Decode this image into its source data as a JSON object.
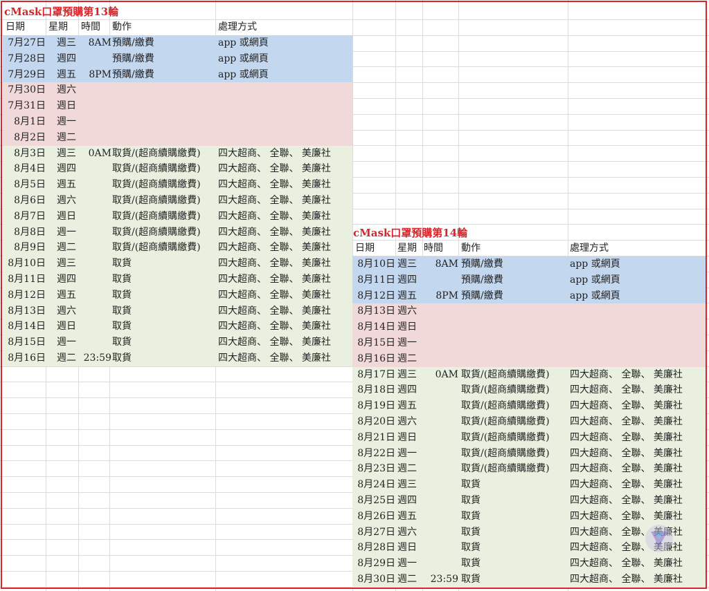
{
  "round13": {
    "title": "cMask口罩預購第13輪",
    "headers": [
      "日期",
      "星期",
      "時間",
      "動作",
      "處理方式"
    ],
    "rows": [
      {
        "date": "7月27日",
        "weekday": "週三",
        "time": "8AM",
        "action": "預購/繳費",
        "method": "app 或網頁",
        "color": "blue"
      },
      {
        "date": "7月28日",
        "weekday": "週四",
        "time": "",
        "action": "預購/繳費",
        "method": "app 或網頁",
        "color": "blue"
      },
      {
        "date": "7月29日",
        "weekday": "週五",
        "time": "8PM",
        "action": "預購/繳費",
        "method": "app 或網頁",
        "color": "blue"
      },
      {
        "date": "7月30日",
        "weekday": "週六",
        "time": "",
        "action": "",
        "method": "",
        "color": "pink"
      },
      {
        "date": "7月31日",
        "weekday": "週日",
        "time": "",
        "action": "",
        "method": "",
        "color": "pink"
      },
      {
        "date": "8月1日",
        "weekday": "週一",
        "time": "",
        "action": "",
        "method": "",
        "color": "pink"
      },
      {
        "date": "8月2日",
        "weekday": "週二",
        "time": "",
        "action": "",
        "method": "",
        "color": "pink"
      },
      {
        "date": "8月3日",
        "weekday": "週三",
        "time": "0AM",
        "action": "取貨/(超商續購繳費)",
        "method": "四大超商、 全聯、 美廉社",
        "color": "green"
      },
      {
        "date": "8月4日",
        "weekday": "週四",
        "time": "",
        "action": "取貨/(超商續購繳費)",
        "method": "四大超商、 全聯、 美廉社",
        "color": "green"
      },
      {
        "date": "8月5日",
        "weekday": "週五",
        "time": "",
        "action": "取貨/(超商續購繳費)",
        "method": "四大超商、 全聯、 美廉社",
        "color": "green"
      },
      {
        "date": "8月6日",
        "weekday": "週六",
        "time": "",
        "action": "取貨/(超商續購繳費)",
        "method": "四大超商、 全聯、 美廉社",
        "color": "green"
      },
      {
        "date": "8月7日",
        "weekday": "週日",
        "time": "",
        "action": "取貨/(超商續購繳費)",
        "method": "四大超商、 全聯、 美廉社",
        "color": "green"
      },
      {
        "date": "8月8日",
        "weekday": "週一",
        "time": "",
        "action": "取貨/(超商續購繳費)",
        "method": "四大超商、 全聯、 美廉社",
        "color": "green"
      },
      {
        "date": "8月9日",
        "weekday": "週二",
        "time": "",
        "action": "取貨/(超商續購繳費)",
        "method": "四大超商、 全聯、 美廉社",
        "color": "green"
      },
      {
        "date": "8月10日",
        "weekday": "週三",
        "time": "",
        "action": "取貨",
        "method": "四大超商、 全聯、 美廉社",
        "color": "green"
      },
      {
        "date": "8月11日",
        "weekday": "週四",
        "time": "",
        "action": "取貨",
        "method": "四大超商、 全聯、 美廉社",
        "color": "green"
      },
      {
        "date": "8月12日",
        "weekday": "週五",
        "time": "",
        "action": "取貨",
        "method": "四大超商、 全聯、 美廉社",
        "color": "green"
      },
      {
        "date": "8月13日",
        "weekday": "週六",
        "time": "",
        "action": "取貨",
        "method": "四大超商、 全聯、 美廉社",
        "color": "green"
      },
      {
        "date": "8月14日",
        "weekday": "週日",
        "time": "",
        "action": "取貨",
        "method": "四大超商、 全聯、 美廉社",
        "color": "green"
      },
      {
        "date": "8月15日",
        "weekday": "週一",
        "time": "",
        "action": "取貨",
        "method": "四大超商、 全聯、 美廉社",
        "color": "green"
      },
      {
        "date": "8月16日",
        "weekday": "週二",
        "time": "23:59",
        "action": "取貨",
        "method": "四大超商、 全聯、 美廉社",
        "color": "green"
      }
    ]
  },
  "round14": {
    "title": "cMask口罩預購第14輪",
    "headers": [
      "日期",
      "星期",
      "時間",
      "動作",
      "處理方式"
    ],
    "rows": [
      {
        "date": "8月10日",
        "weekday": "週三",
        "time": "8AM",
        "action": "預購/繳費",
        "method": "app 或網頁",
        "color": "blue"
      },
      {
        "date": "8月11日",
        "weekday": "週四",
        "time": "",
        "action": "預購/繳費",
        "method": "app 或網頁",
        "color": "blue"
      },
      {
        "date": "8月12日",
        "weekday": "週五",
        "time": "8PM",
        "action": "預購/繳費",
        "method": "app 或網頁",
        "color": "blue"
      },
      {
        "date": "8月13日",
        "weekday": "週六",
        "time": "",
        "action": "",
        "method": "",
        "color": "pink"
      },
      {
        "date": "8月14日",
        "weekday": "週日",
        "time": "",
        "action": "",
        "method": "",
        "color": "pink"
      },
      {
        "date": "8月15日",
        "weekday": "週一",
        "time": "",
        "action": "",
        "method": "",
        "color": "pink"
      },
      {
        "date": "8月16日",
        "weekday": "週二",
        "time": "",
        "action": "",
        "method": "",
        "color": "pink"
      },
      {
        "date": "8月17日",
        "weekday": "週三",
        "time": "0AM",
        "action": "取貨/(超商續購繳費)",
        "method": "四大超商、 全聯、 美廉社",
        "color": "green"
      },
      {
        "date": "8月18日",
        "weekday": "週四",
        "time": "",
        "action": "取貨/(超商續購繳費)",
        "method": "四大超商、 全聯、 美廉社",
        "color": "green"
      },
      {
        "date": "8月19日",
        "weekday": "週五",
        "time": "",
        "action": "取貨/(超商續購繳費)",
        "method": "四大超商、 全聯、 美廉社",
        "color": "green"
      },
      {
        "date": "8月20日",
        "weekday": "週六",
        "time": "",
        "action": "取貨/(超商續購繳費)",
        "method": "四大超商、 全聯、 美廉社",
        "color": "green"
      },
      {
        "date": "8月21日",
        "weekday": "週日",
        "time": "",
        "action": "取貨/(超商續購繳費)",
        "method": "四大超商、 全聯、 美廉社",
        "color": "green"
      },
      {
        "date": "8月22日",
        "weekday": "週一",
        "time": "",
        "action": "取貨/(超商續購繳費)",
        "method": "四大超商、 全聯、 美廉社",
        "color": "green"
      },
      {
        "date": "8月23日",
        "weekday": "週二",
        "time": "",
        "action": "取貨/(超商續購繳費)",
        "method": "四大超商、 全聯、 美廉社",
        "color": "green"
      },
      {
        "date": "8月24日",
        "weekday": "週三",
        "time": "",
        "action": "取貨",
        "method": "四大超商、 全聯、 美廉社",
        "color": "green"
      },
      {
        "date": "8月25日",
        "weekday": "週四",
        "time": "",
        "action": "取貨",
        "method": "四大超商、 全聯、 美廉社",
        "color": "green"
      },
      {
        "date": "8月26日",
        "weekday": "週五",
        "time": "",
        "action": "取貨",
        "method": "四大超商、 全聯、 美廉社",
        "color": "green"
      },
      {
        "date": "8月27日",
        "weekday": "週六",
        "time": "",
        "action": "取貨",
        "method": "四大超商、 全聯、 美廉社",
        "color": "green"
      },
      {
        "date": "8月28日",
        "weekday": "週日",
        "time": "",
        "action": "取貨",
        "method": "四大超商、 全聯、 美廉社",
        "color": "green"
      },
      {
        "date": "8月29日",
        "weekday": "週一",
        "time": "",
        "action": "取貨",
        "method": "四大超商、 全聯、 美廉社",
        "color": "green"
      },
      {
        "date": "8月30日",
        "weekday": "週二",
        "time": "23:59",
        "action": "取貨",
        "method": "四大超商、 全聯、 美廉社",
        "color": "green"
      }
    ]
  },
  "colors": {
    "blue": "#c3d7ef",
    "pink": "#f2d9d9",
    "green": "#eaf0df",
    "title_red": "#d9252a"
  },
  "watermark_icon": "logo-icon"
}
